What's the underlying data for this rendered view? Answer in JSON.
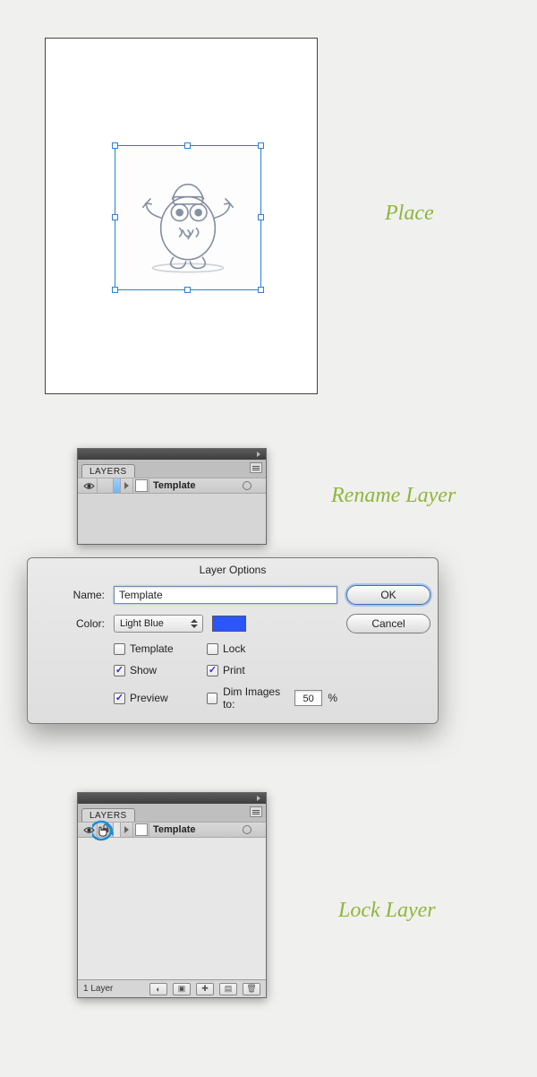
{
  "captions": {
    "place": "Place",
    "rename": "Rename Layer",
    "lock": "Lock Layer"
  },
  "layersPanel": {
    "tab": "LAYERS",
    "layerName": "Template",
    "status": "1 Layer"
  },
  "dialog": {
    "title": "Layer Options",
    "nameLabel": "Name:",
    "nameValue": "Template",
    "colorLabel": "Color:",
    "colorSelect": "Light Blue",
    "colorHex": "#2b55ff",
    "okLabel": "OK",
    "cancelLabel": "Cancel",
    "checks": {
      "template": "Template",
      "lock": "Lock",
      "show": "Show",
      "print": "Print",
      "preview": "Preview",
      "dimLabel": "Dim Images to:",
      "dimValue": "50",
      "dimSuffix": "%"
    },
    "checkedStates": {
      "template": false,
      "lock": false,
      "show": true,
      "print": true,
      "preview": true,
      "dim": false
    }
  }
}
